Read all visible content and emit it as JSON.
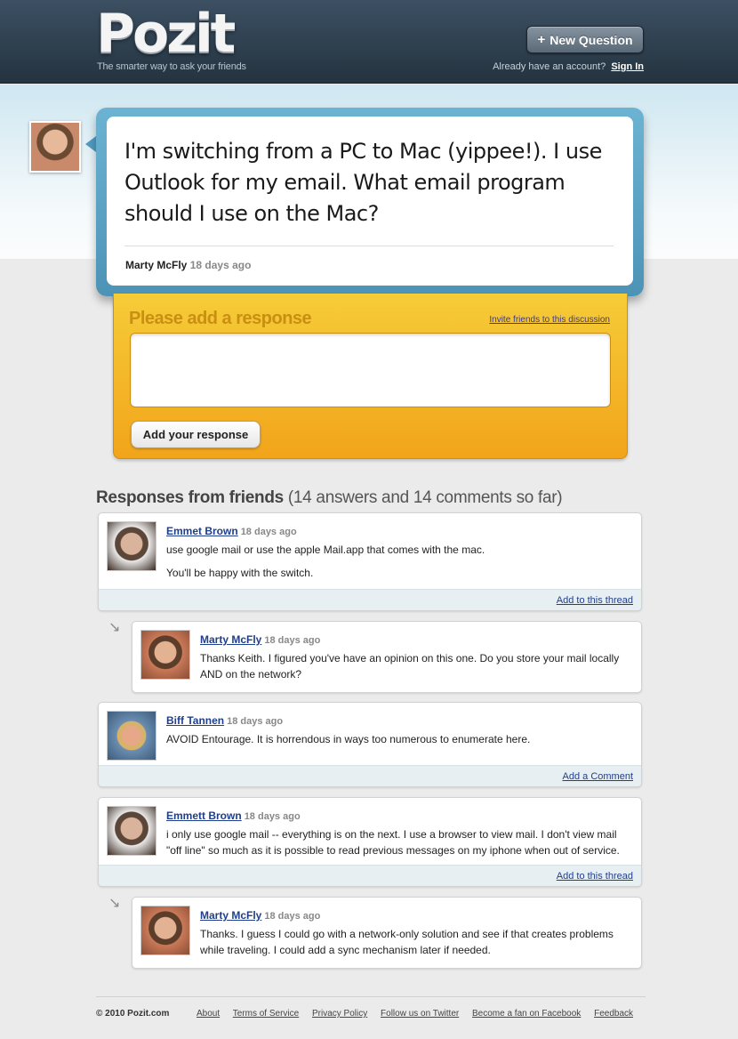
{
  "header": {
    "logo": "Pozit",
    "tagline": "The smarter way to ask your friends",
    "new_question_icon": "+",
    "new_question_label": "New Question",
    "account_prompt": "Already have an account?",
    "sign_in": "Sign In"
  },
  "question": {
    "text": "I'm switching from a PC to Mac (yippee!). I use Outlook for my email. What email program should I use on the Mac?",
    "author": "Marty McFly",
    "time": "18 days ago"
  },
  "response_form": {
    "title": "Please add a response",
    "invite_link": "Invite friends to this discussion",
    "textarea_value": "",
    "submit_label": "Add your response"
  },
  "responses_header": {
    "title": "Responses from friends",
    "summary": "(14 answers and 14 comments so far)"
  },
  "responses": [
    {
      "author": "Emmet Brown",
      "time": "18 days ago",
      "body": [
        "use google mail or use the apple Mail.app that comes with the mac.",
        "You'll be happy with the switch."
      ],
      "footer_link": "Add to this thread"
    },
    {
      "author": "Marty McFly",
      "time": "18 days ago",
      "body": [
        "Thanks Keith. I figured you've have an opinion on this one. Do you store your mail locally AND on the network?"
      ]
    },
    {
      "author": "Biff Tannen",
      "time": "18 days ago",
      "body": [
        "AVOID Entourage. It is horrendous in ways too numerous to enumerate here."
      ],
      "footer_link": "Add a Comment"
    },
    {
      "author": "Emmett Brown",
      "time": "18 days ago",
      "body": [
        "i only use google mail -- everything is on the next. I use a browser to view mail. I don't view mail \"off line\" so much as it is possible to read previous messages on my iphone when out of service."
      ],
      "footer_link": "Add to this thread"
    },
    {
      "author": "Marty McFly",
      "time": "18 days ago",
      "body": [
        "Thanks. I guess I could go with a network-only solution and see if that creates problems while traveling. I could add a sync mechanism later if needed."
      ]
    }
  ],
  "footer": {
    "copyright": "© 2010 Pozit.com",
    "links": [
      "About",
      "Terms of Service",
      "Privacy Policy",
      "Follow us on Twitter",
      "Become a fan on Facebook",
      "Feedback"
    ]
  }
}
